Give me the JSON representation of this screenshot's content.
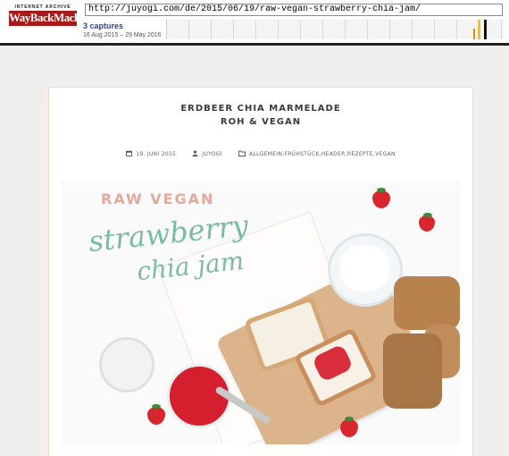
{
  "wayback": {
    "logo_top": "INTERNET ARCHIVE",
    "logo_main": "WayBackMachine",
    "url": "http://juyogi.com/de/2015/06/19/raw-vegan-strawberry-chia-jam/",
    "captures": "3 captures",
    "range": "16 Aug 2015 – 29 May 2016"
  },
  "article": {
    "title_line1": "ERDBEER CHIA MARMELADE",
    "title_line2": "ROH & VEGAN",
    "date": "19. JUNI 2015",
    "author": "JUYOGI",
    "categories": "ALLGEMEIN,FRÜHSTÜCK,HEADER,REZEPTE,VEGAN"
  },
  "photo": {
    "overlay_top": "RAW VEGAN",
    "overlay_script1": "strawberry",
    "overlay_script2": "chia jam"
  },
  "icons": {
    "calendar": "calendar-icon",
    "user": "user-icon",
    "folder": "folder-icon"
  },
  "colors": {
    "wayback_red": "#a71a1a",
    "captures_link": "#2b44a8",
    "card_border": "#f0dcc9",
    "raw_vegan_pink": "#e7a79a",
    "script_green": "#79bca2"
  }
}
